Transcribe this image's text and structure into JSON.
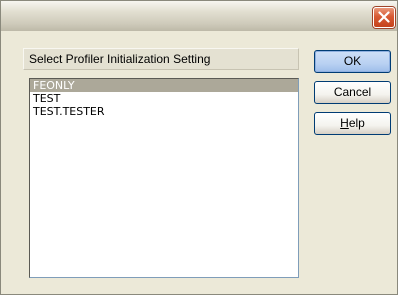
{
  "window": {
    "title": "",
    "close_icon": "close-x"
  },
  "dialog": {
    "list_label": "Select Profiler Initialization Setting",
    "items": [
      "FEONLY",
      "TEST",
      "TEST.TESTER"
    ],
    "selected_item": "FEONLY"
  },
  "buttons": {
    "ok_label": "OK",
    "cancel_label": "Cancel",
    "help_mnemonic": "H",
    "help_rest": "elp"
  },
  "colors": {
    "selection": "#aca899",
    "close_button": "#d85a34",
    "dialog_background": "#ece9d8"
  }
}
